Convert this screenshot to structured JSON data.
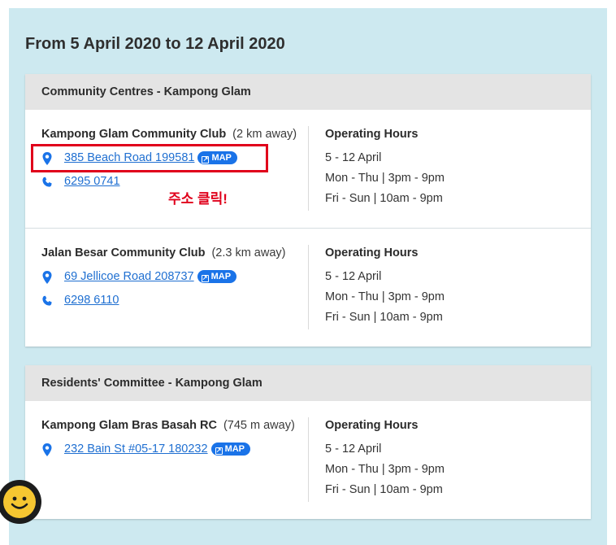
{
  "page": {
    "heading": "From 5 April 2020 to 12 April 2020"
  },
  "sections": [
    {
      "title": "Community Centres - Kampong Glam",
      "entries": [
        {
          "name": "Kampong Glam Community Club",
          "distance": "(2 km away)",
          "address": "385 Beach Road 199581",
          "map_label": "MAP",
          "phone": "6295 0741",
          "hours_title": "Operating Hours",
          "hours": [
            "5 - 12 April",
            "Mon - Thu | 3pm - 9pm",
            "Fri - Sun | 10am - 9pm"
          ]
        },
        {
          "name": "Jalan Besar Community Club",
          "distance": "(2.3 km away)",
          "address": "69 Jellicoe Road 208737",
          "map_label": "MAP",
          "phone": "6298 6110",
          "hours_title": "Operating Hours",
          "hours": [
            "5 - 12 April",
            "Mon - Thu | 3pm - 9pm",
            "Fri - Sun | 10am - 9pm"
          ]
        }
      ]
    },
    {
      "title": "Residents' Committee - Kampong Glam",
      "entries": [
        {
          "name": "Kampong Glam Bras Basah RC",
          "distance": "(745 m away)",
          "address": "232 Bain St #05-17 180232",
          "map_label": "MAP",
          "hours_title": "Operating Hours",
          "hours": [
            "5 - 12 April",
            "Mon - Thu | 3pm - 9pm",
            "Fri - Sun | 10am - 9pm"
          ]
        }
      ]
    }
  ],
  "annotation": {
    "text": "주소 클릭!",
    "color": "#e0001b"
  },
  "colors": {
    "accent": "#1a73e8",
    "link": "#1f6fd1",
    "background": "#cde9f0"
  },
  "icons": {
    "pin": "location-pin-icon",
    "phone": "phone-icon",
    "map": "external-link-icon",
    "chat": "smiley-chat-icon"
  }
}
